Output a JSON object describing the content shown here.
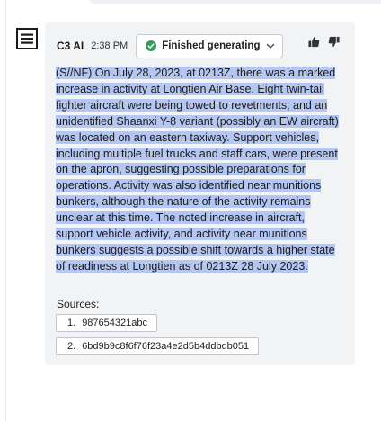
{
  "message": {
    "author": "C3 AI",
    "time": "2:38 PM",
    "status": "Finished generating",
    "body": "(S//NF) On July 28, 2023, at 0213Z, there was a marked increase in activity at Longtien Air Base. Eight twin-tail fighter aircraft were being towed to revetments, and an unidentified Shaanxi Y-8 variant (possibly an EW aircraft) was located on an eastern taxiway. Support vehicles, including multiple fuel trucks and staff cars, were present on the apron, suggesting possible preparations for operations. Activity was also identified near munitions bunkers, although the nature of the activity remains unclear at this time. The noted increase in aircraft, support vehicle activity, and activity near munitions bunkers suggests a possible shift towards a higher state of readiness at Longtien as of 0213Z 28 July 2023."
  },
  "sources": {
    "label": "Sources:",
    "items": [
      {
        "num": "1.",
        "id": "987654321abc"
      },
      {
        "num": "2.",
        "id": "6bd9b9c8f6f76f23a4e2d5b4ddbdb051"
      }
    ]
  },
  "icons": {
    "logo": "c3-logo-icon",
    "status": "check-circle-icon",
    "dropdown": "chevron-down-icon",
    "like": "thumbs-up-icon",
    "dislike": "thumbs-down-icon"
  },
  "colors": {
    "card_bg": "#f2f3f4",
    "highlight": "#b4c6f2",
    "status_green": "#3a9a5b"
  }
}
